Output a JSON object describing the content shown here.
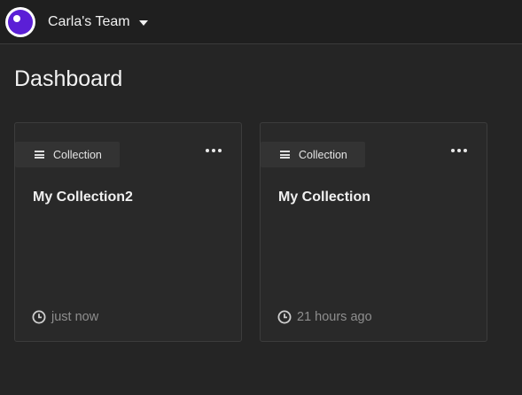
{
  "header": {
    "team_name": "Carla's Team",
    "logo_icon": "logo-circle-icon",
    "dropdown_icon": "caret-down-icon"
  },
  "page": {
    "title": "Dashboard"
  },
  "cards": [
    {
      "type_label": "Collection",
      "type_icon": "list-icon",
      "title": "My Collection2",
      "updated": "just now",
      "menu_icon": "more-horizontal-icon"
    },
    {
      "type_label": "Collection",
      "type_icon": "list-icon",
      "title": "My Collection",
      "updated": "21 hours ago",
      "menu_icon": "more-horizontal-icon"
    }
  ],
  "colors": {
    "background": "#252525",
    "topbar": "#1f1f1f",
    "card": "#292929",
    "accent": "#5b1fd6"
  }
}
